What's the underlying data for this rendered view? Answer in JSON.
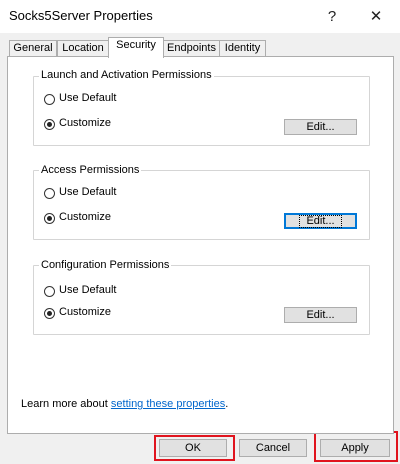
{
  "window": {
    "title": "Socks5Server Properties",
    "help_glyph": "?",
    "close_glyph": "✕"
  },
  "tabs": [
    {
      "label": "General",
      "selected": false
    },
    {
      "label": "Location",
      "selected": false
    },
    {
      "label": "Security",
      "selected": true
    },
    {
      "label": "Endpoints",
      "selected": false
    },
    {
      "label": "Identity",
      "selected": false
    }
  ],
  "groups": [
    {
      "label": "Launch and Activation Permissions",
      "options": {
        "use_default": "Use Default",
        "customize": "Customize"
      },
      "selected": "customize",
      "edit_label": "Edit..."
    },
    {
      "label": "Access Permissions",
      "options": {
        "use_default": "Use Default",
        "customize": "Customize"
      },
      "selected": "customize",
      "edit_label": "Edit..."
    },
    {
      "label": "Configuration Permissions",
      "options": {
        "use_default": "Use Default",
        "customize": "Customize"
      },
      "selected": "customize",
      "edit_label": "Edit..."
    }
  ],
  "learn_more": {
    "prefix": "Learn more about ",
    "link": "setting these properties",
    "suffix": "."
  },
  "footer": {
    "ok_label": "OK",
    "cancel_label": "Cancel",
    "apply_label": "Apply"
  },
  "colors": {
    "highlight": "#e0141e",
    "link": "#0066cc",
    "focus": "#0078d7"
  },
  "icons": {
    "help": "help-icon",
    "close": "close-icon"
  }
}
